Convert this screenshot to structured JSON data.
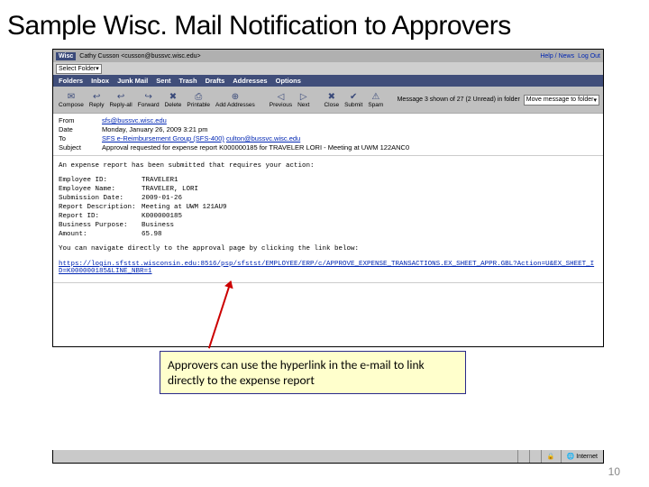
{
  "slide": {
    "title": "Sample Wisc. Mail Notification to Approvers",
    "page_number": "10"
  },
  "banner": {
    "logo": "Wisc",
    "user": "Cathy Cusson <cusson@bussvc.wisc.edu>",
    "help": "Help / News",
    "logout": "Log Out"
  },
  "folder": {
    "select": "Select Folder"
  },
  "tabs": {
    "items": [
      "Folders",
      "Inbox",
      "Junk Mail",
      "Sent",
      "Trash",
      "Drafts",
      "Addresses",
      "Options"
    ]
  },
  "toolbar": {
    "compose": "Compose",
    "reply": "Reply",
    "replyall": "Reply-all",
    "forward": "Forward",
    "delete": "Delete",
    "printable": "Printable",
    "addaddr": "Add Addresses",
    "prev": "Previous",
    "next": "Next",
    "close": "Close",
    "submit": "Submit",
    "spam": "Spam",
    "right_info": "Message 3 shown of 27 (2 Unread) in folder",
    "move": "Move message to folder"
  },
  "headers": {
    "from_lbl": "From",
    "from_val": "sfs@bussvc.wisc.edu",
    "date_lbl": "Date",
    "date_val": "Monday, January 26, 2009 3:21 pm",
    "to_lbl": "To",
    "to_val": "SFS e-Reimbursement Group (SFS-400)",
    "to_email": "culton@bussvc.wisc.edu",
    "subj_lbl": "Subject",
    "subj_val": "Approval requested for expense report K000000185 for TRAVELER LORI - Meeting at UWM 122ANC0"
  },
  "body": {
    "intro": "An expense report has been submitted that requires your action:",
    "fields": {
      "emp_id_k": "Employee ID:",
      "emp_id_v": "TRAVELER1",
      "emp_nm_k": "Employee Name:",
      "emp_nm_v": "TRAVELER, LORI",
      "sub_dt_k": "Submission Date:",
      "sub_dt_v": "2009-01-26",
      "rpt_k": "Report Description:",
      "rpt_v": "Meeting at UWM 121AU9",
      "rpt_id_k": "Report ID:",
      "rpt_id_v": "K000000185",
      "purp_k": "Business Purpose:",
      "purp_v": "Business",
      "amt_k": "Amount:",
      "amt_v": "65.98"
    },
    "nav_text": "You can navigate directly to the approval page by clicking the link below:",
    "link": "https://login.sfstst.wisconsin.edu:8516/psp/sfstst/EMPLOYEE/ERP/c/APPROVE_EXPENSE_TRANSACTIONS.EX_SHEET_APPR.GBL?Action=U&EX_SHEET_ID=K000000185&LINE_NBR=1"
  },
  "callout": {
    "text": "Approvers can use the hyperlink in the e-mail to link directly to the expense report"
  },
  "status": {
    "zone": "Internet"
  }
}
